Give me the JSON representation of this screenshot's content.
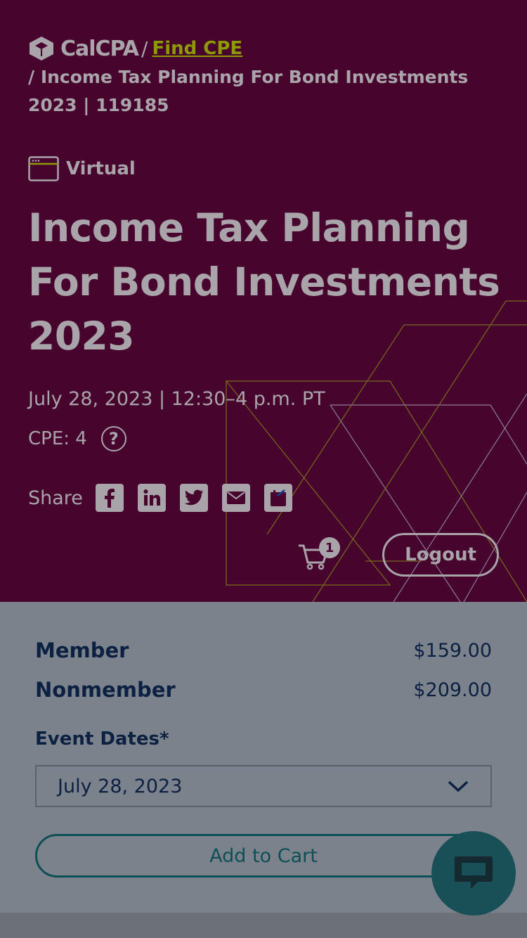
{
  "breadcrumb": {
    "brand": "CalCPA",
    "separator": "/",
    "link": "Find CPE",
    "path": "/ Income Tax Planning For Bond Investments 2023 | 119185"
  },
  "event": {
    "format": "Virtual",
    "title": "Income Tax Planning For Bond Investments 2023",
    "date_time": "July 28, 2023 | 12:30–4 p.m. PT",
    "cpe_label": "CPE: 4",
    "help_glyph": "?"
  },
  "share": {
    "label": "Share",
    "icons": [
      "facebook-icon",
      "linkedin-icon",
      "twitter-icon",
      "email-icon",
      "calendar-icon"
    ]
  },
  "cart": {
    "count": "1"
  },
  "header": {
    "logout_label": "Logout"
  },
  "pricing": {
    "member_label": "Member",
    "member_price": "$159.00",
    "nonmember_label": "Nonmember",
    "nonmember_price": "$209.00"
  },
  "event_dates": {
    "label": "Event Dates*",
    "selected": "July 28, 2023"
  },
  "actions": {
    "add_to_cart": "Add to Cart"
  },
  "colors": {
    "hero_bg": "#47052e",
    "panel_bg": "#7c828b",
    "accent_link": "#8c9a06",
    "text_dark": "#0c2142",
    "teal": "#0e4f56"
  }
}
